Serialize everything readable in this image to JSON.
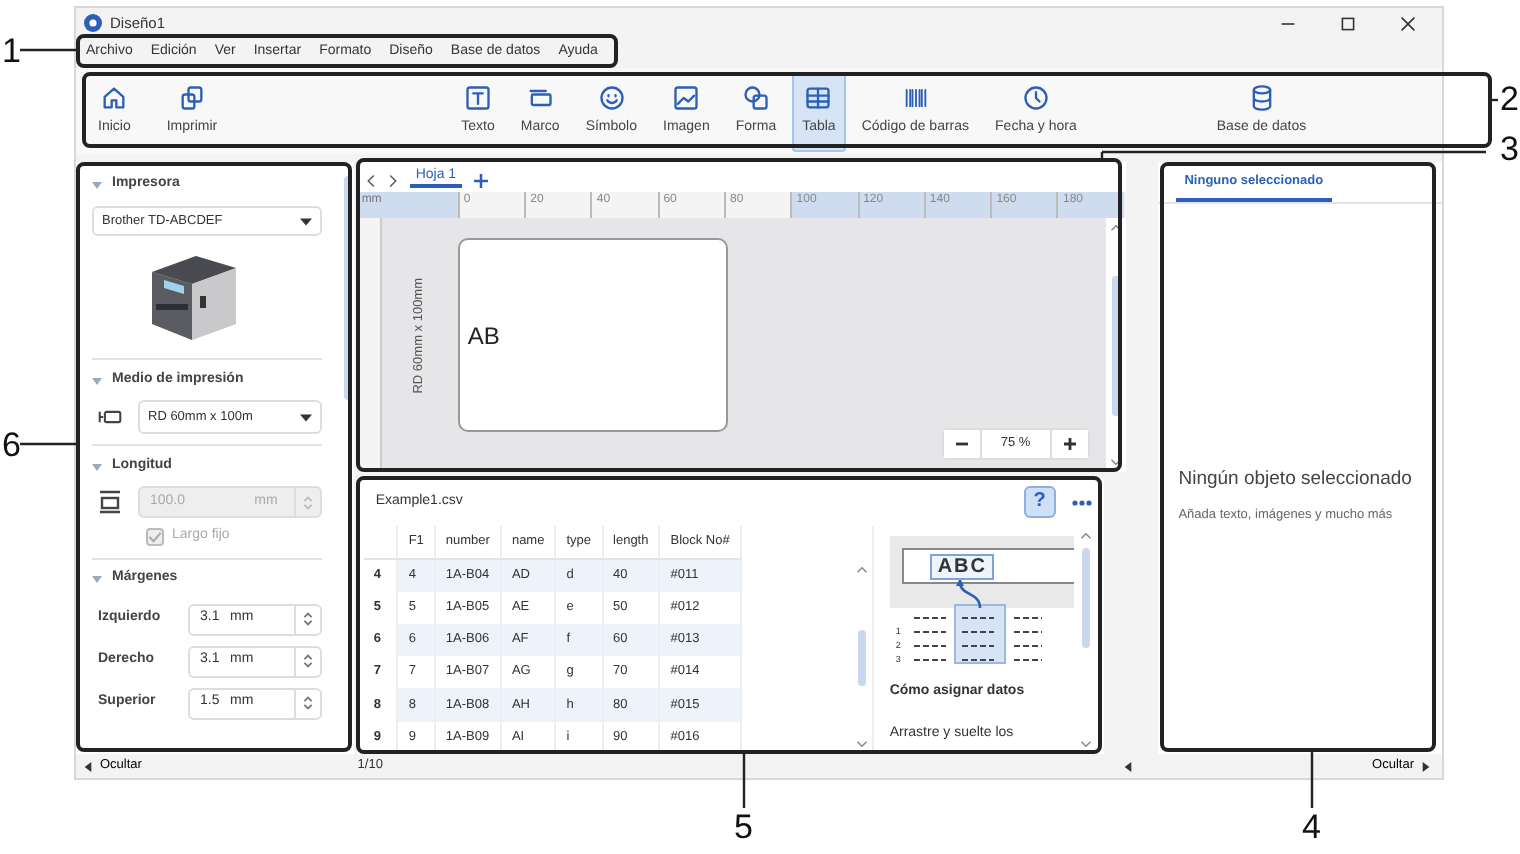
{
  "window": {
    "title": "Diseño1"
  },
  "menu": [
    "Archivo",
    "Edición",
    "Ver",
    "Insertar",
    "Formato",
    "Diseño",
    "Base de datos",
    "Ayuda"
  ],
  "toolbar": {
    "groups": [
      [
        {
          "label": "Inicio",
          "selected": false
        },
        {
          "label": "Imprimir",
          "selected": false
        }
      ],
      [
        {
          "label": "Texto",
          "selected": false
        },
        {
          "label": "Marco",
          "selected": false
        },
        {
          "label": "Símbolo",
          "selected": false
        },
        {
          "label": "Imagen",
          "selected": false
        },
        {
          "label": "Forma",
          "selected": false
        },
        {
          "label": "Tabla",
          "selected": true
        },
        {
          "label": "Código de barras",
          "selected": false
        },
        {
          "label": "Fecha y hora",
          "selected": false
        }
      ],
      [
        {
          "label": "Base de datos",
          "selected": false
        }
      ]
    ]
  },
  "left_panel": {
    "printer": {
      "title": "Impresora",
      "expanded": true,
      "model": "Brother TD-ABCDEF"
    },
    "media": {
      "title": "Medio de impresión",
      "expanded": true,
      "value": "RD 60mm x 100m"
    },
    "length": {
      "title": "Longitud",
      "expanded": true,
      "value": "100.0",
      "unit": "mm",
      "disabled": true,
      "fixed": {
        "label": "Largo fijo",
        "checked": true,
        "disabled": true
      }
    },
    "margins": {
      "title": "Márgenes",
      "expanded": true,
      "rows": [
        {
          "label": "Izquierdo",
          "value": "3.1",
          "unit": "mm"
        },
        {
          "label": "Derecho",
          "value": "3.1",
          "unit": "mm"
        },
        {
          "label": "Superior",
          "value": "1.5",
          "unit": "mm"
        }
      ]
    },
    "hide": "Ocultar"
  },
  "canvas": {
    "sheets": [
      {
        "label": "Hoja 1",
        "selected": true
      }
    ],
    "ruler": {
      "unit": "mm",
      "labels": [
        "0",
        "20",
        "40",
        "60",
        "80",
        "100",
        "120",
        "140",
        "160",
        "180"
      ]
    },
    "label": {
      "size": "RD 60mm x 100mm",
      "text": "AB"
    },
    "zoom": "75 %"
  },
  "data_panel": {
    "file": "Example1.csv",
    "help": "?",
    "columns": [
      "F1",
      "number",
      "name",
      "type",
      "length",
      "Block No#"
    ],
    "rows": [
      {
        "index": "4",
        "cells": [
          "4",
          "1A-B04",
          "AD",
          "d",
          "40",
          "#011"
        ]
      },
      {
        "index": "5",
        "cells": [
          "5",
          "1A-B05",
          "AE",
          "e",
          "50",
          "#012"
        ]
      },
      {
        "index": "6",
        "cells": [
          "6",
          "1A-B06",
          "AF",
          "f",
          "60",
          "#013"
        ]
      },
      {
        "index": "7",
        "cells": [
          "7",
          "1A-B07",
          "AG",
          "g",
          "70",
          "#014"
        ]
      },
      {
        "index": "8",
        "cells": [
          "8",
          "1A-B08",
          "AH",
          "h",
          "80",
          "#015"
        ]
      },
      {
        "index": "9",
        "cells": [
          "9",
          "1A-B09",
          "AI",
          "i",
          "90",
          "#016"
        ]
      }
    ],
    "help_card": {
      "image_text": "ABC",
      "image_rows": [
        "1",
        "2",
        "3"
      ],
      "title": "Cómo asignar datos",
      "text": "Arrastre y suelte los"
    },
    "page": "1/10"
  },
  "properties": {
    "tabs": [
      {
        "label": "Ninguno seleccionado",
        "selected": true
      }
    ],
    "message": "Ningún objeto seleccionado",
    "hint": "Añada texto, imágenes y mucho más",
    "hide": "Ocultar"
  },
  "callouts": [
    "1",
    "2",
    "3",
    "4",
    "5",
    "6"
  ]
}
